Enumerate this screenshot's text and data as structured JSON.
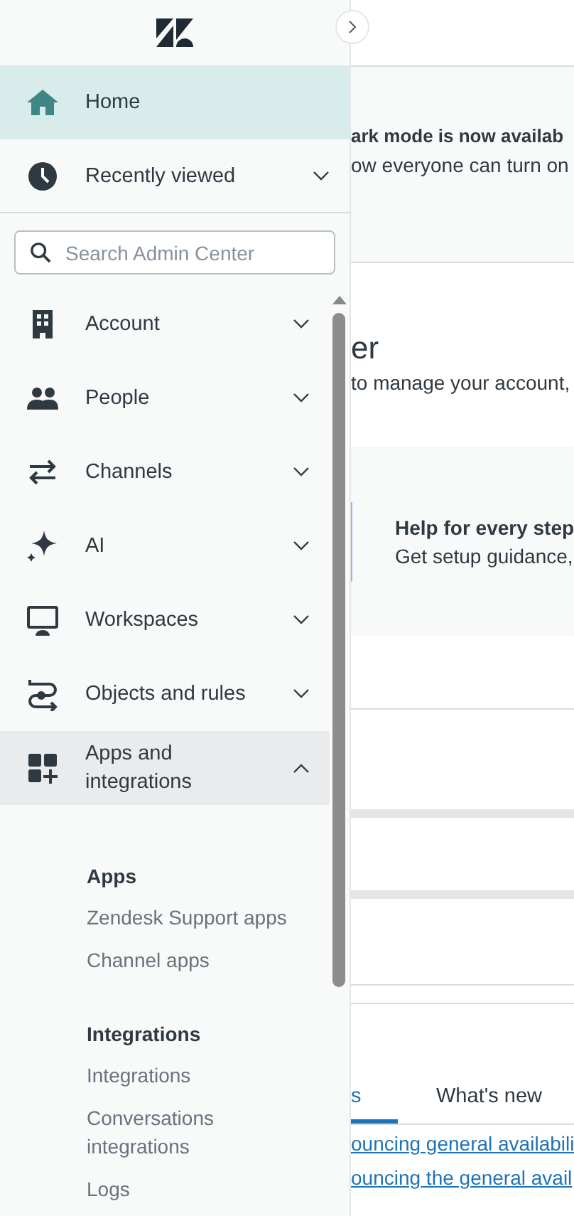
{
  "top_nav": [
    {
      "label": "Home",
      "selected": true,
      "expandable": false
    },
    {
      "label": "Recently viewed",
      "selected": false,
      "expandable": true
    }
  ],
  "search": {
    "placeholder": "Search Admin Center"
  },
  "nav": [
    {
      "label": "Account",
      "expanded": false
    },
    {
      "label": "People",
      "expanded": false
    },
    {
      "label": "Channels",
      "expanded": false
    },
    {
      "label": "AI",
      "expanded": false
    },
    {
      "label": "Workspaces",
      "expanded": false
    },
    {
      "label": "Objects and rules",
      "expanded": false
    },
    {
      "label": "Apps and integrations",
      "expanded": true,
      "sections": [
        {
          "heading": "Apps",
          "links": [
            "Zendesk Support apps",
            "Channel apps"
          ]
        },
        {
          "heading": "Integrations",
          "links": [
            "Integrations",
            "Conversations integrations",
            "Logs"
          ]
        }
      ]
    }
  ],
  "main": {
    "banner": {
      "title": "ark mode is now availab",
      "text": "ow everyone can turn on"
    },
    "heading": "er",
    "subheading": "to manage your account,",
    "help_card": {
      "title": "Help for every step",
      "text": "Get setup guidance,"
    },
    "tabs": [
      {
        "label": "s",
        "selected": true
      },
      {
        "label": "What's new",
        "selected": false
      }
    ],
    "links": [
      "ouncing general availabili",
      "ouncing the general avail"
    ]
  }
}
